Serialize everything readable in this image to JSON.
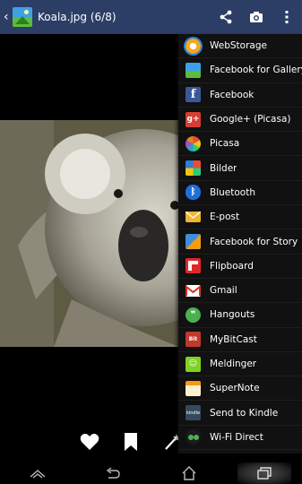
{
  "header": {
    "title": "Koala.jpg (6/8)",
    "back_icon": "chevron-left-icon",
    "app_icon": "gallery-icon",
    "actions": [
      "share-icon",
      "camera-icon",
      "overflow-menu-icon"
    ]
  },
  "share_menu": {
    "items": [
      {
        "label": "WebStorage",
        "icon": "webstorage-icon",
        "color": "#f5a623"
      },
      {
        "label": "Facebook for Gallery",
        "icon": "gallery-app-icon",
        "color": "#3ea1e8"
      },
      {
        "label": "Facebook",
        "icon": "facebook-icon",
        "color": "#3b5998"
      },
      {
        "label": "Google+ (Picasa)",
        "icon": "google-plus-icon",
        "color": "#d73d32"
      },
      {
        "label": "Picasa",
        "icon": "picasa-icon",
        "color": "#8e44ad"
      },
      {
        "label": "Bilder",
        "icon": "bilder-icon",
        "color": "#2c7fd6"
      },
      {
        "label": "Bluetooth",
        "icon": "bluetooth-icon",
        "color": "#1e6fd9"
      },
      {
        "label": "E-post",
        "icon": "email-icon",
        "color": "#f0b431"
      },
      {
        "label": "Facebook for Story",
        "icon": "story-icon",
        "color": "#3f8fd8"
      },
      {
        "label": "Flipboard",
        "icon": "flipboard-icon",
        "color": "#e12828"
      },
      {
        "label": "Gmail",
        "icon": "gmail-icon",
        "color": "#ffffff"
      },
      {
        "label": "Hangouts",
        "icon": "hangouts-icon",
        "color": "#4caf50"
      },
      {
        "label": "MyBitCast",
        "icon": "mybitcast-icon",
        "color": "#c0392b"
      },
      {
        "label": "Meldinger",
        "icon": "messaging-icon",
        "color": "#7ed321"
      },
      {
        "label": "SuperNote",
        "icon": "supernote-icon",
        "color": "#f7c46c"
      },
      {
        "label": "Send to Kindle",
        "icon": "kindle-icon",
        "color": "#34495e"
      },
      {
        "label": "Wi-Fi Direct",
        "icon": "wifi-direct-icon",
        "color": "#2e7d32"
      }
    ]
  },
  "bottom_actions": [
    "favorite-heart-icon",
    "bookmark-icon",
    "magic-wand-icon"
  ],
  "navigation": [
    "recent-apps-icon",
    "back-icon",
    "home-icon",
    "multitask-icon"
  ]
}
